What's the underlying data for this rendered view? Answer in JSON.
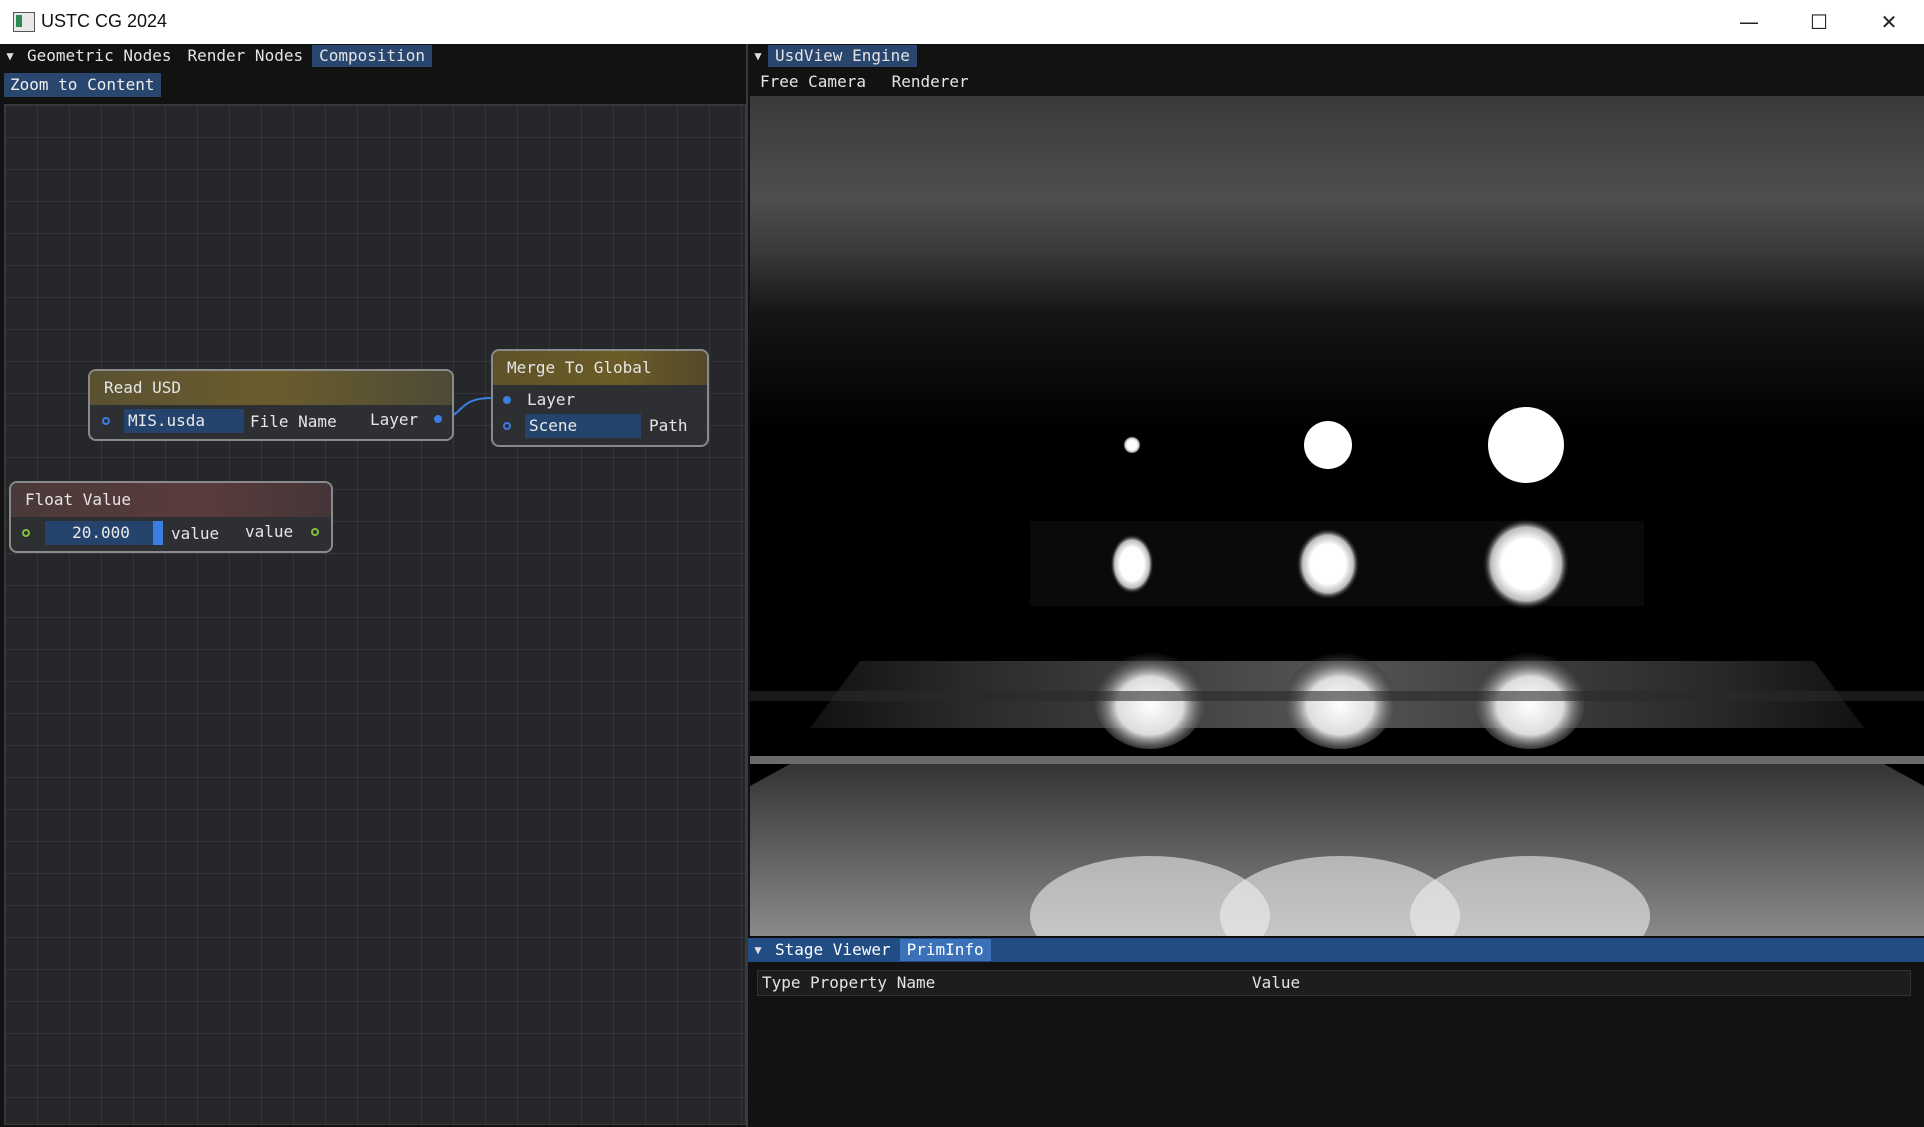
{
  "window": {
    "title": "USTC CG 2024",
    "icon": "app-window-icon",
    "controls": [
      "minimize-icon",
      "maximize-icon",
      "close-icon"
    ]
  },
  "left_panel": {
    "tabs": [
      {
        "label": "Geometric Nodes",
        "active": false
      },
      {
        "label": "Render Nodes",
        "active": false
      },
      {
        "label": "Composition",
        "active": true
      }
    ],
    "zoom_button": "Zoom to Content",
    "nodes": {
      "read_usd": {
        "title": "Read USD",
        "file_value": "MIS.usda",
        "file_label": "File Name",
        "output_label": "Layer"
      },
      "merge": {
        "title": "Merge To Global",
        "input_label": "Layer",
        "path_value": "Scene",
        "path_label": "Path"
      },
      "float_value": {
        "title": "Float Value",
        "value": "20.000",
        "input_label": "value",
        "output_label": "value"
      }
    }
  },
  "right_panel": {
    "tabs": [
      {
        "label": "UsdView Engine",
        "active": true
      }
    ],
    "menu": [
      "Free Camera",
      "Renderer"
    ]
  },
  "stage_panel": {
    "tabs": [
      {
        "label": "Stage Viewer",
        "active": false
      },
      {
        "label": "PrimInfo",
        "active": true
      }
    ],
    "columns": {
      "type": "Type",
      "property": "Property Name",
      "value": "Value"
    }
  },
  "colors": {
    "accent_tab": "#28466e",
    "stage_bar": "#214d84",
    "pin_blue": "#3b7de0",
    "pin_green": "#7ec23a"
  }
}
